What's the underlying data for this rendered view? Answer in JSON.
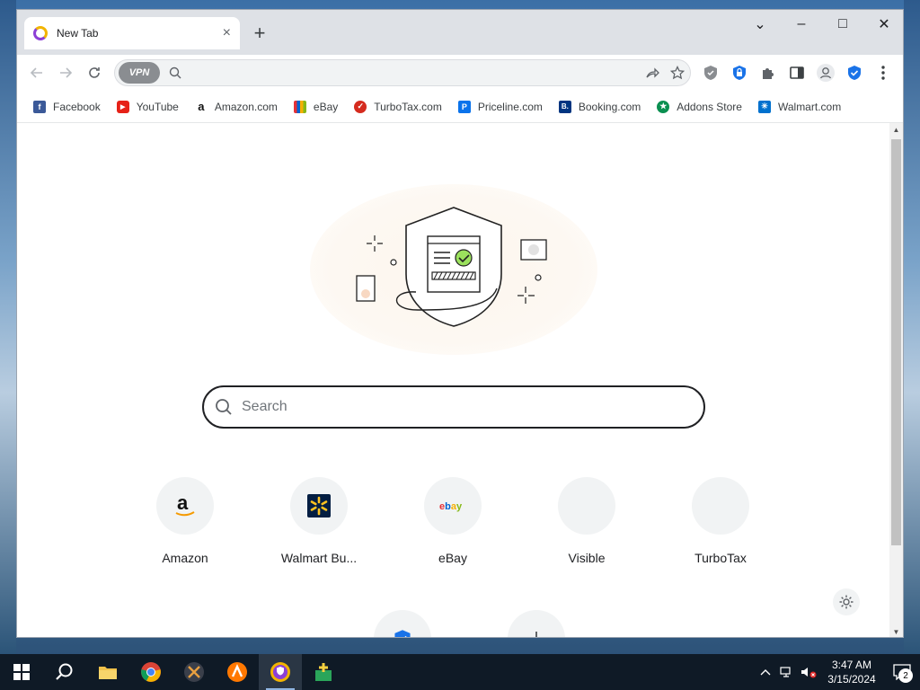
{
  "browser": {
    "tab": {
      "title": "New Tab",
      "close": "×"
    },
    "new_tab": "+",
    "window_controls": {
      "dropdown": "⌄",
      "minimize": "–",
      "maximize": "□",
      "close": "✕"
    },
    "omnibox": {
      "vpn_label": "VPN",
      "value": "",
      "placeholder": ""
    },
    "extensions": [
      "shield-extension-icon",
      "blue-lock-extension-icon",
      "puzzle-extensions-icon",
      "side-panel-icon",
      "profile-icon",
      "blue-shield-extension-icon",
      "menu-dots-icon"
    ]
  },
  "bookmarks": [
    {
      "label": "Facebook",
      "color": "#3b5998",
      "glyph": "f"
    },
    {
      "label": "YouTube",
      "color": "#e62117",
      "glyph": "▶"
    },
    {
      "label": "Amazon.com",
      "color": "#ffffff",
      "glyph": "a"
    },
    {
      "label": "eBay",
      "color": "#f5af02",
      "glyph": ""
    },
    {
      "label": "TurboTax.com",
      "color": "#d52b1e",
      "glyph": "✓"
    },
    {
      "label": "Priceline.com",
      "color": "#0a73eb",
      "glyph": "P"
    },
    {
      "label": "Booking.com",
      "color": "#003580",
      "glyph": "B."
    },
    {
      "label": "Addons Store",
      "color": "#0a8f50",
      "glyph": "★"
    },
    {
      "label": "Walmart.com",
      "color": "#0071ce",
      "glyph": "✳"
    }
  ],
  "newtab": {
    "search_placeholder": "Search",
    "shortcuts": [
      {
        "label": "Amazon",
        "icon": "amazon-logo"
      },
      {
        "label": "Walmart Bu...",
        "icon": "walmart-logo"
      },
      {
        "label": "eBay",
        "icon": "ebay-logo"
      },
      {
        "label": "Visible",
        "icon": "blank"
      },
      {
        "label": "TurboTax",
        "icon": "blank"
      }
    ]
  },
  "taskbar": {
    "apps": [
      "windows-start-icon",
      "search-icon",
      "file-explorer-icon",
      "chrome-icon",
      "app-x-icon",
      "avast-icon",
      "browser-shield-icon",
      "green-plus-app-icon"
    ],
    "clock": {
      "time": "3:47 AM",
      "date": "3/15/2024"
    },
    "notifications_count": "2"
  }
}
